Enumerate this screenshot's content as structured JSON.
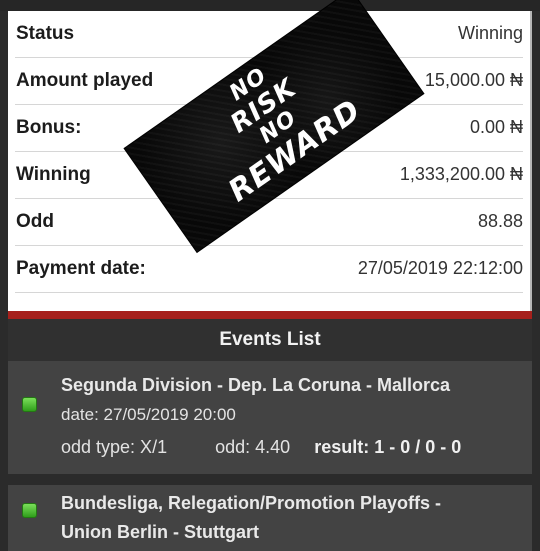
{
  "summary": {
    "rows": [
      {
        "label": "Status",
        "value": "Winning"
      },
      {
        "label": "Amount played",
        "value": "15,000.00 ₦"
      },
      {
        "label": "Bonus:",
        "value": "0.00 ₦"
      },
      {
        "label": "Winning",
        "value": "1,333,200.00 ₦"
      },
      {
        "label": "Odd",
        "value": "88.88"
      },
      {
        "label": "Payment date:",
        "value": "27/05/2019 22:12:00"
      }
    ]
  },
  "overlay": {
    "line1": "NO",
    "line2": "RISK",
    "line3": "NO",
    "line4": "REWARD"
  },
  "events": {
    "header": "Events List",
    "items": [
      {
        "title": "Segunda Division - Dep. La Coruna - Mallorca",
        "date": "date: 27/05/2019 20:00",
        "odd_type": "odd type: X/1",
        "odd": "odd: 4.40",
        "result": "result: 1 - 0 / 0 - 0"
      },
      {
        "title_line1": "Bundesliga, Relegation/Promotion Playoffs -",
        "title_line2": "Union Berlin - Stuttgart"
      }
    ]
  },
  "colors": {
    "status_ok": "#3fb526",
    "accent": "#a6201c"
  }
}
